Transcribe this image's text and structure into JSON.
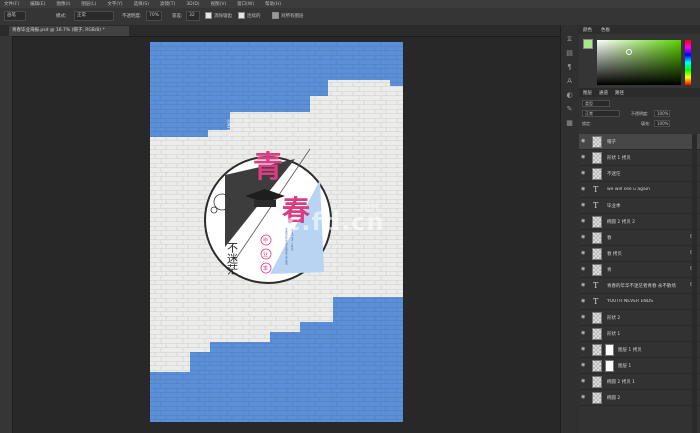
{
  "menubar": {
    "items": [
      "文件(F)",
      "编辑(E)",
      "图像(I)",
      "图层(L)",
      "文字(Y)",
      "选择(S)",
      "滤镜(T)",
      "3D(D)",
      "视图(V)",
      "窗口(W)",
      "帮助(H)"
    ]
  },
  "options": {
    "brush_label": "画笔",
    "mode_label": "模式:",
    "mode_value": "正常",
    "opacity_label": "不透明度:",
    "opacity_value": "70%",
    "flow_label": "容差:",
    "flow_value": "32",
    "antialias_label": "消除锯齿",
    "contiguous_label": "连续的",
    "all_layers_label": "对所有图层"
  },
  "document": {
    "tab_title": "青春毕业海报.psd @ 16.7% (帽子, RGB/8) *"
  },
  "color_panel": {
    "tab1": "颜色",
    "tab2": "色板"
  },
  "layers_panel": {
    "tab1": "图层",
    "tab2": "通道",
    "tab3": "路径",
    "filter_kind": "类型",
    "blend_mode": "正常",
    "opacity_label": "不透明度:",
    "opacity_value": "100%",
    "lock_label": "锁定:",
    "fill_label": "填充:",
    "fill_value": "100%",
    "layers": [
      {
        "name": "帽子",
        "type": "image",
        "selected": true,
        "fx": false,
        "mask": false
      },
      {
        "name": "形状 1 拷贝",
        "type": "image",
        "selected": false,
        "fx": false,
        "mask": false
      },
      {
        "name": "不迷茫",
        "type": "image",
        "selected": false,
        "fx": false,
        "mask": false
      },
      {
        "name": "we will see u again",
        "type": "text",
        "selected": false,
        "fx": false,
        "mask": false
      },
      {
        "name": "毕业季",
        "type": "text",
        "selected": false,
        "fx": false,
        "mask": false
      },
      {
        "name": "椭圆 2 拷贝 2",
        "type": "image",
        "selected": false,
        "fx": false,
        "mask": false
      },
      {
        "name": "春",
        "type": "image",
        "selected": false,
        "fx": true,
        "mask": false
      },
      {
        "name": "春 拷贝",
        "type": "image",
        "selected": false,
        "fx": true,
        "mask": false
      },
      {
        "name": "青",
        "type": "image",
        "selected": false,
        "fx": true,
        "mask": false
      },
      {
        "name": "青春的年华不迷茫者青春 永不散场",
        "type": "text",
        "selected": false,
        "fx": true,
        "mask": false
      },
      {
        "name": "YOUTH NEVER ENDS",
        "type": "text",
        "selected": false,
        "fx": false,
        "mask": false
      },
      {
        "name": "形状 2",
        "type": "image",
        "selected": false,
        "fx": false,
        "mask": false
      },
      {
        "name": "形状 1",
        "type": "image",
        "selected": false,
        "fx": false,
        "mask": false
      },
      {
        "name": "图层 1 拷贝",
        "type": "image",
        "selected": false,
        "fx": false,
        "mask": true
      },
      {
        "name": "图层 1",
        "type": "image",
        "selected": false,
        "fx": false,
        "mask": true
      },
      {
        "name": "椭圆 2 拷贝 1",
        "type": "image",
        "selected": false,
        "fx": false,
        "mask": false
      },
      {
        "name": "椭圆 2",
        "type": "image",
        "selected": false,
        "fx": false,
        "mask": false
      }
    ]
  },
  "poster": {
    "char1": "青",
    "char2": "春",
    "side_text": "YOUTH NEVER ENDS",
    "vertical_text": "不迷茫",
    "badge_chars": [
      "毕",
      "业",
      "季"
    ],
    "slogan": "青春的年华不迷茫者青春 永不散场",
    "english": "we will see u again"
  },
  "watermark": {
    "text": "pc.fd.cn",
    "subtext": "现代"
  },
  "colors": {
    "blue": "#5b8fd8",
    "pink": "#d93d82",
    "dark": "#3a3a3a",
    "light_blue": "#b9d4f2"
  }
}
